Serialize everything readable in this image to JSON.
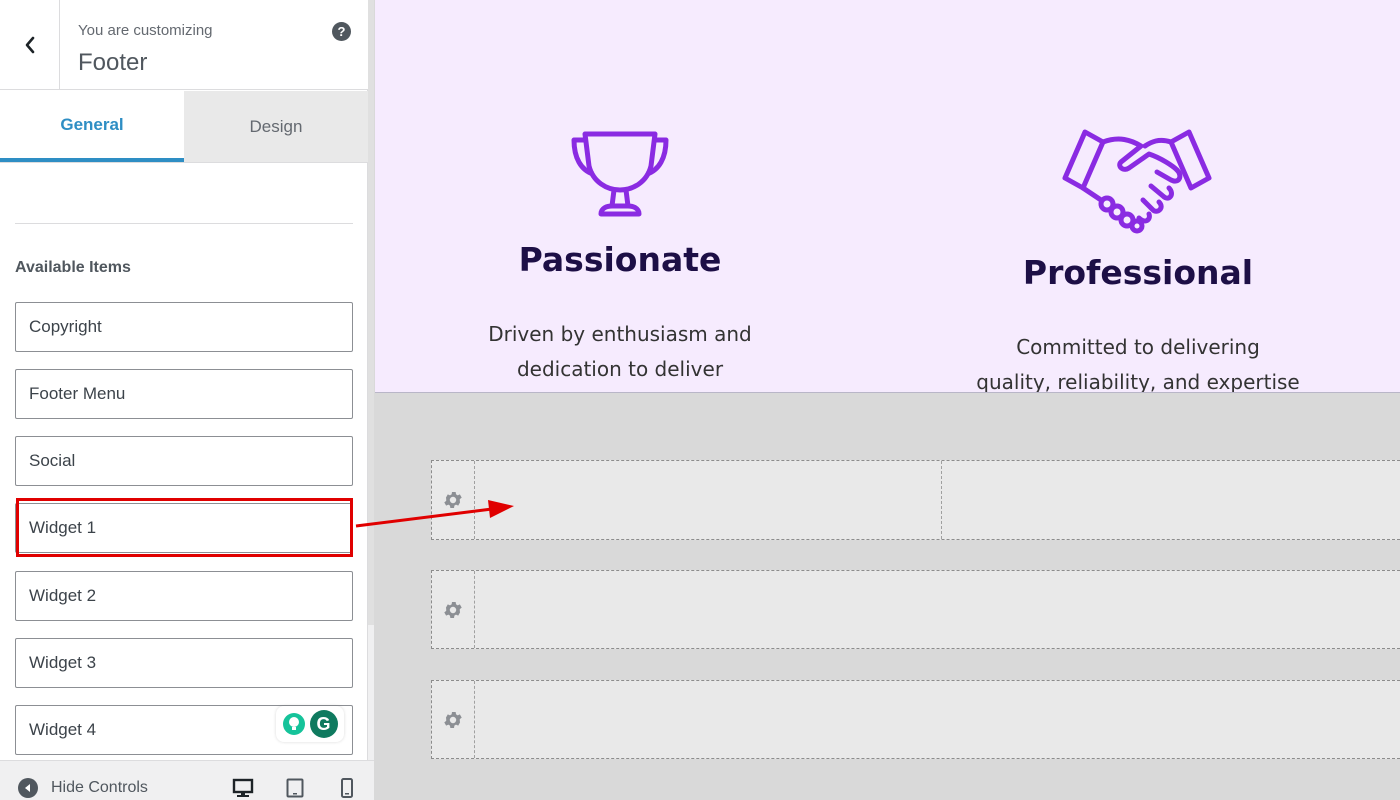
{
  "header": {
    "customizing_label": "You are customizing",
    "section_title": "Footer",
    "help_symbol": "?"
  },
  "tabs": [
    {
      "label": "General",
      "active": true
    },
    {
      "label": "Design",
      "active": false
    }
  ],
  "available_items": {
    "title": "Available Items",
    "items": [
      "Copyright",
      "Footer Menu",
      "Social",
      "Widget 1",
      "Widget 2",
      "Widget 3",
      "Widget 4"
    ],
    "highlighted": "Widget 1"
  },
  "grammarly": {
    "logo_letter": "G"
  },
  "footer_bar": {
    "hide_controls_label": "Hide Controls",
    "devices": [
      "desktop-icon",
      "tablet-icon",
      "mobile-icon"
    ]
  },
  "preview": {
    "features": [
      {
        "icon": "trophy-icon",
        "title": "Passionate",
        "desc_line1": "Driven by enthusiasm and",
        "desc_line2": "dedication to deliver"
      },
      {
        "icon": "handshake-icon",
        "title": "Professional",
        "desc_line1": "Committed to delivering",
        "desc_line2": "quality, reliability, and expertise"
      }
    ],
    "builder_rows": 3
  },
  "colors": {
    "accent": "#2e8ec4",
    "highlight": "#e00000",
    "icon_purple": "#8a2be2",
    "preview_bg": "#f6ebfe",
    "heading": "#1d0f46"
  }
}
